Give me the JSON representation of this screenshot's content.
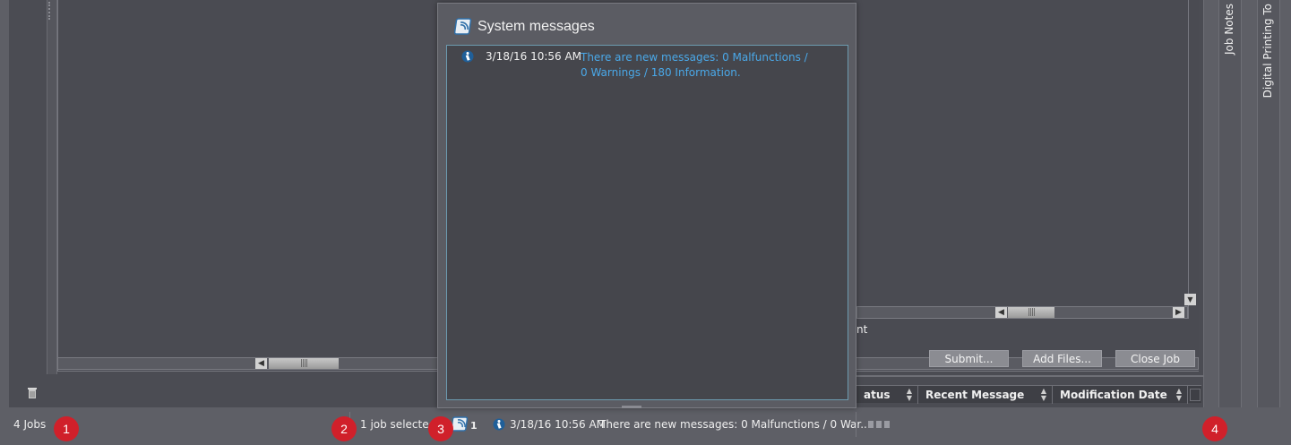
{
  "side_tabs": [
    "Job Notes",
    "Digital Printing To"
  ],
  "job_panel": {
    "partial_label": "nt",
    "buttons": {
      "submit": "Submit...",
      "add_files": "Add Files...",
      "close_job": "Close Job"
    },
    "columns": [
      "atus",
      "Recent Message",
      "Modification Date"
    ]
  },
  "status_bar": {
    "jobs_count": "4 Jobs",
    "selection": "1 job selected",
    "message_count": "1",
    "latest_message_time": "3/18/16 10:56 AM",
    "latest_message_text": "There are new messages: 0 Malfunctions / 0 War..."
  },
  "markers": [
    "1",
    "2",
    "3",
    "4"
  ],
  "popup": {
    "title": "System messages",
    "messages": [
      {
        "time": "3/18/16 10:56 AM",
        "text": "There are new messages: 0 Malfunctions / 0 Warnings / 180 Information."
      }
    ]
  },
  "colors": {
    "marker": "#d0202a",
    "message_link": "#4aa8e8",
    "panel": "#4b4c53"
  },
  "icons": [
    "trash-icon",
    "system-messages-icon",
    "info-icon",
    "status-bars-icon",
    "scroll-left-icon",
    "scroll-right-icon",
    "scroll-down-icon",
    "sort-icon"
  ]
}
